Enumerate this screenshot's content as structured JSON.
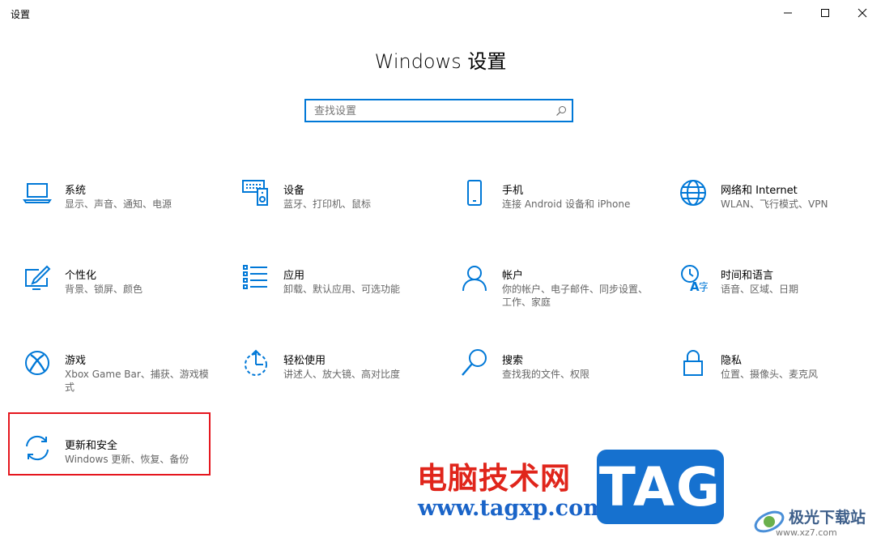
{
  "window": {
    "title": "设置",
    "minimize_glyph": "–",
    "maximize_glyph": "☐",
    "close_glyph": "✕"
  },
  "page": {
    "title": "Windows 设置"
  },
  "search": {
    "placeholder": "查找设置",
    "value": "",
    "icon": "search-icon"
  },
  "tiles": [
    {
      "label": "系统",
      "desc": "显示、声音、通知、电源",
      "icon": "laptop-icon"
    },
    {
      "label": "设备",
      "desc": "蓝牙、打印机、鼠标",
      "icon": "devices-icon"
    },
    {
      "label": "手机",
      "desc": "连接 Android 设备和 iPhone",
      "icon": "phone-icon"
    },
    {
      "label": "网络和 Internet",
      "desc": "WLAN、飞行模式、VPN",
      "icon": "globe-icon"
    },
    {
      "label": "个性化",
      "desc": "背景、锁屏、颜色",
      "icon": "personalization-icon"
    },
    {
      "label": "应用",
      "desc": "卸载、默认应用、可选功能",
      "icon": "apps-list-icon"
    },
    {
      "label": "帐户",
      "desc": "你的帐户、电子邮件、同步设置、工作、家庭",
      "icon": "person-icon"
    },
    {
      "label": "时间和语言",
      "desc": "语音、区域、日期",
      "icon": "time-language-icon"
    },
    {
      "label": "游戏",
      "desc": "Xbox Game Bar、捕获、游戏模式",
      "icon": "xbox-icon"
    },
    {
      "label": "轻松使用",
      "desc": "讲述人、放大镜、高对比度",
      "icon": "ease-of-access-icon"
    },
    {
      "label": "搜索",
      "desc": "查找我的文件、权限",
      "icon": "search-icon"
    },
    {
      "label": "隐私",
      "desc": "位置、摄像头、麦克风",
      "icon": "lock-icon"
    },
    {
      "label": "更新和安全",
      "desc": "Windows 更新、恢复、备份",
      "icon": "update-sync-icon"
    }
  ],
  "watermark": {
    "site_cn": "电脑技术网",
    "site_url": "www.tagxp.com",
    "tag": "TAG",
    "brand": "极光下载站",
    "brand_url": "www.xz7.com"
  },
  "colors": {
    "accent": "#0078d7",
    "highlight_border": "#e5161e"
  }
}
